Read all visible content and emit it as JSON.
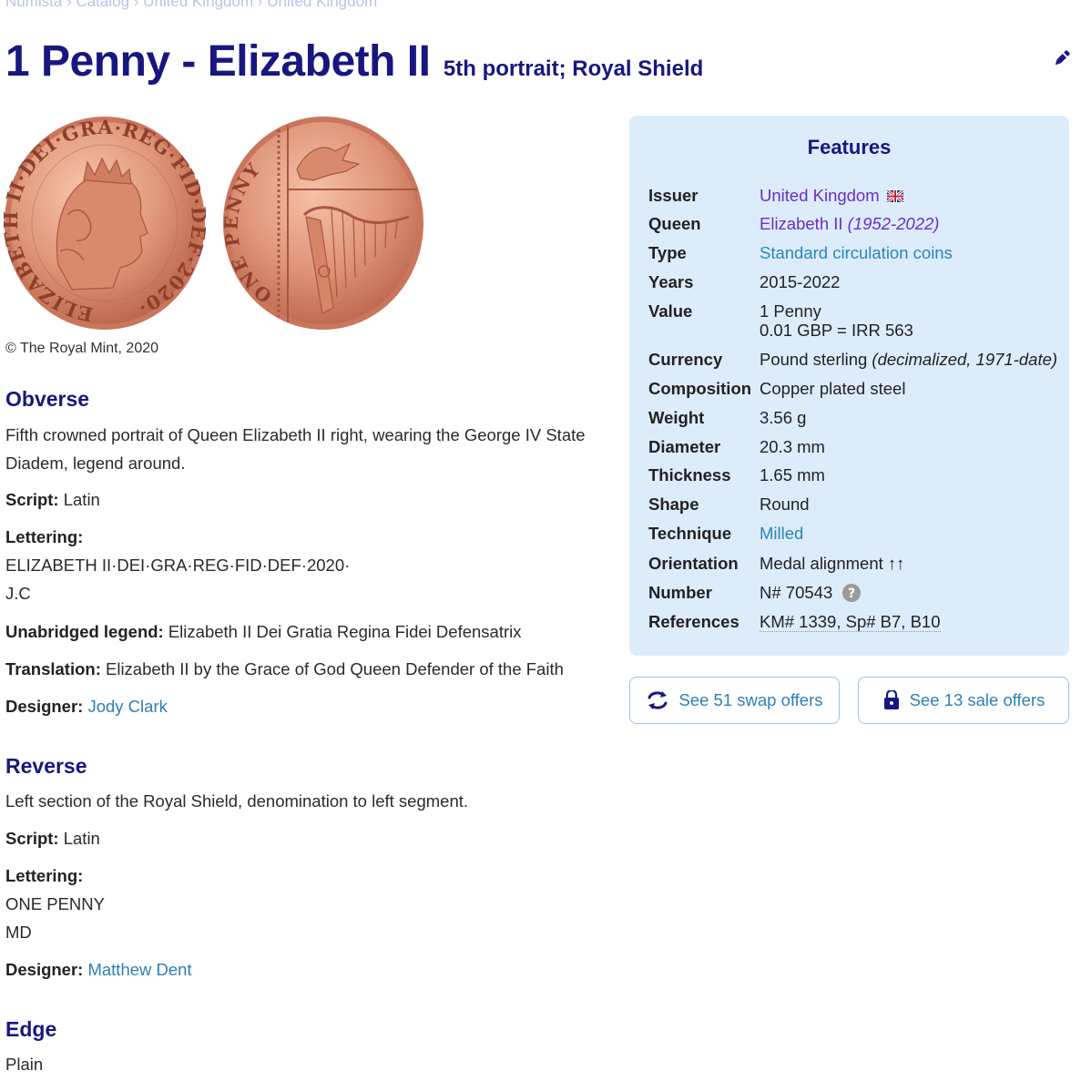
{
  "breadcrumb": "Numista › Catalog › United Kingdom › United Kingdom",
  "title": {
    "main": "1 Penny - Elizabeth II",
    "sub": "5th portrait; Royal Shield"
  },
  "coin": {
    "obverse_legend": "ELIZABETH II·DEI·GRA·REG·FID·DEF·2020·",
    "reverse_legend": "ONE PENNY",
    "copyright": "© The Royal Mint, 2020"
  },
  "obverse": {
    "heading": "Obverse",
    "description": "Fifth crowned portrait of Queen Elizabeth II right, wearing the George IV State Diadem, legend around.",
    "script_label": "Script:",
    "script": "Latin",
    "lettering_label": "Lettering:",
    "lettering_1": "ELIZABETH II·DEI·GRA·REG·FID·DEF·2020·",
    "lettering_2": "J.C",
    "unabridged_label": "Unabridged legend:",
    "unabridged": "Elizabeth II Dei Gratia Regina Fidei Defensatrix",
    "translation_label": "Translation:",
    "translation": "Elizabeth II by the Grace of God Queen Defender of the Faith",
    "designer_label": "Designer:",
    "designer": "Jody Clark"
  },
  "reverse": {
    "heading": "Reverse",
    "description": "Left section of the Royal Shield, denomination to left segment.",
    "script_label": "Script:",
    "script": "Latin",
    "lettering_label": "Lettering:",
    "lettering_1": "ONE PENNY",
    "lettering_2": "MD",
    "designer_label": "Designer:",
    "designer": "Matthew Dent"
  },
  "edge": {
    "heading": "Edge",
    "value": "Plain"
  },
  "features": {
    "heading": "Features",
    "issuer_label": "Issuer",
    "issuer": "United Kingdom",
    "queen_label": "Queen",
    "queen": "Elizabeth II",
    "queen_period": "(1952-2022)",
    "type_label": "Type",
    "type": "Standard circulation coins",
    "years_label": "Years",
    "years": "2015-2022",
    "value_label": "Value",
    "value_1": "1 Penny",
    "value_2": "0.01 GBP = IRR 563",
    "currency_label": "Currency",
    "currency": "Pound sterling",
    "currency_note": "(decimalized, 1971-date)",
    "composition_label": "Composition",
    "composition": "Copper plated steel",
    "weight_label": "Weight",
    "weight": "3.56 g",
    "diameter_label": "Diameter",
    "diameter": "20.3 mm",
    "thickness_label": "Thickness",
    "thickness": "1.65 mm",
    "shape_label": "Shape",
    "shape": "Round",
    "technique_label": "Technique",
    "technique": "Milled",
    "orientation_label": "Orientation",
    "orientation": "Medal alignment ↑↑",
    "number_label": "Number",
    "number": "N# 70543",
    "references_label": "References",
    "references": "KM# 1339, Sp# B7, B10"
  },
  "buttons": {
    "swap": "See 51 swap offers",
    "sale": "See 13 sale offers"
  },
  "colors": {
    "accent": "#18177f",
    "link": "#2d7fb8",
    "panel": "#dcecfb",
    "copper": "#d9866a"
  }
}
